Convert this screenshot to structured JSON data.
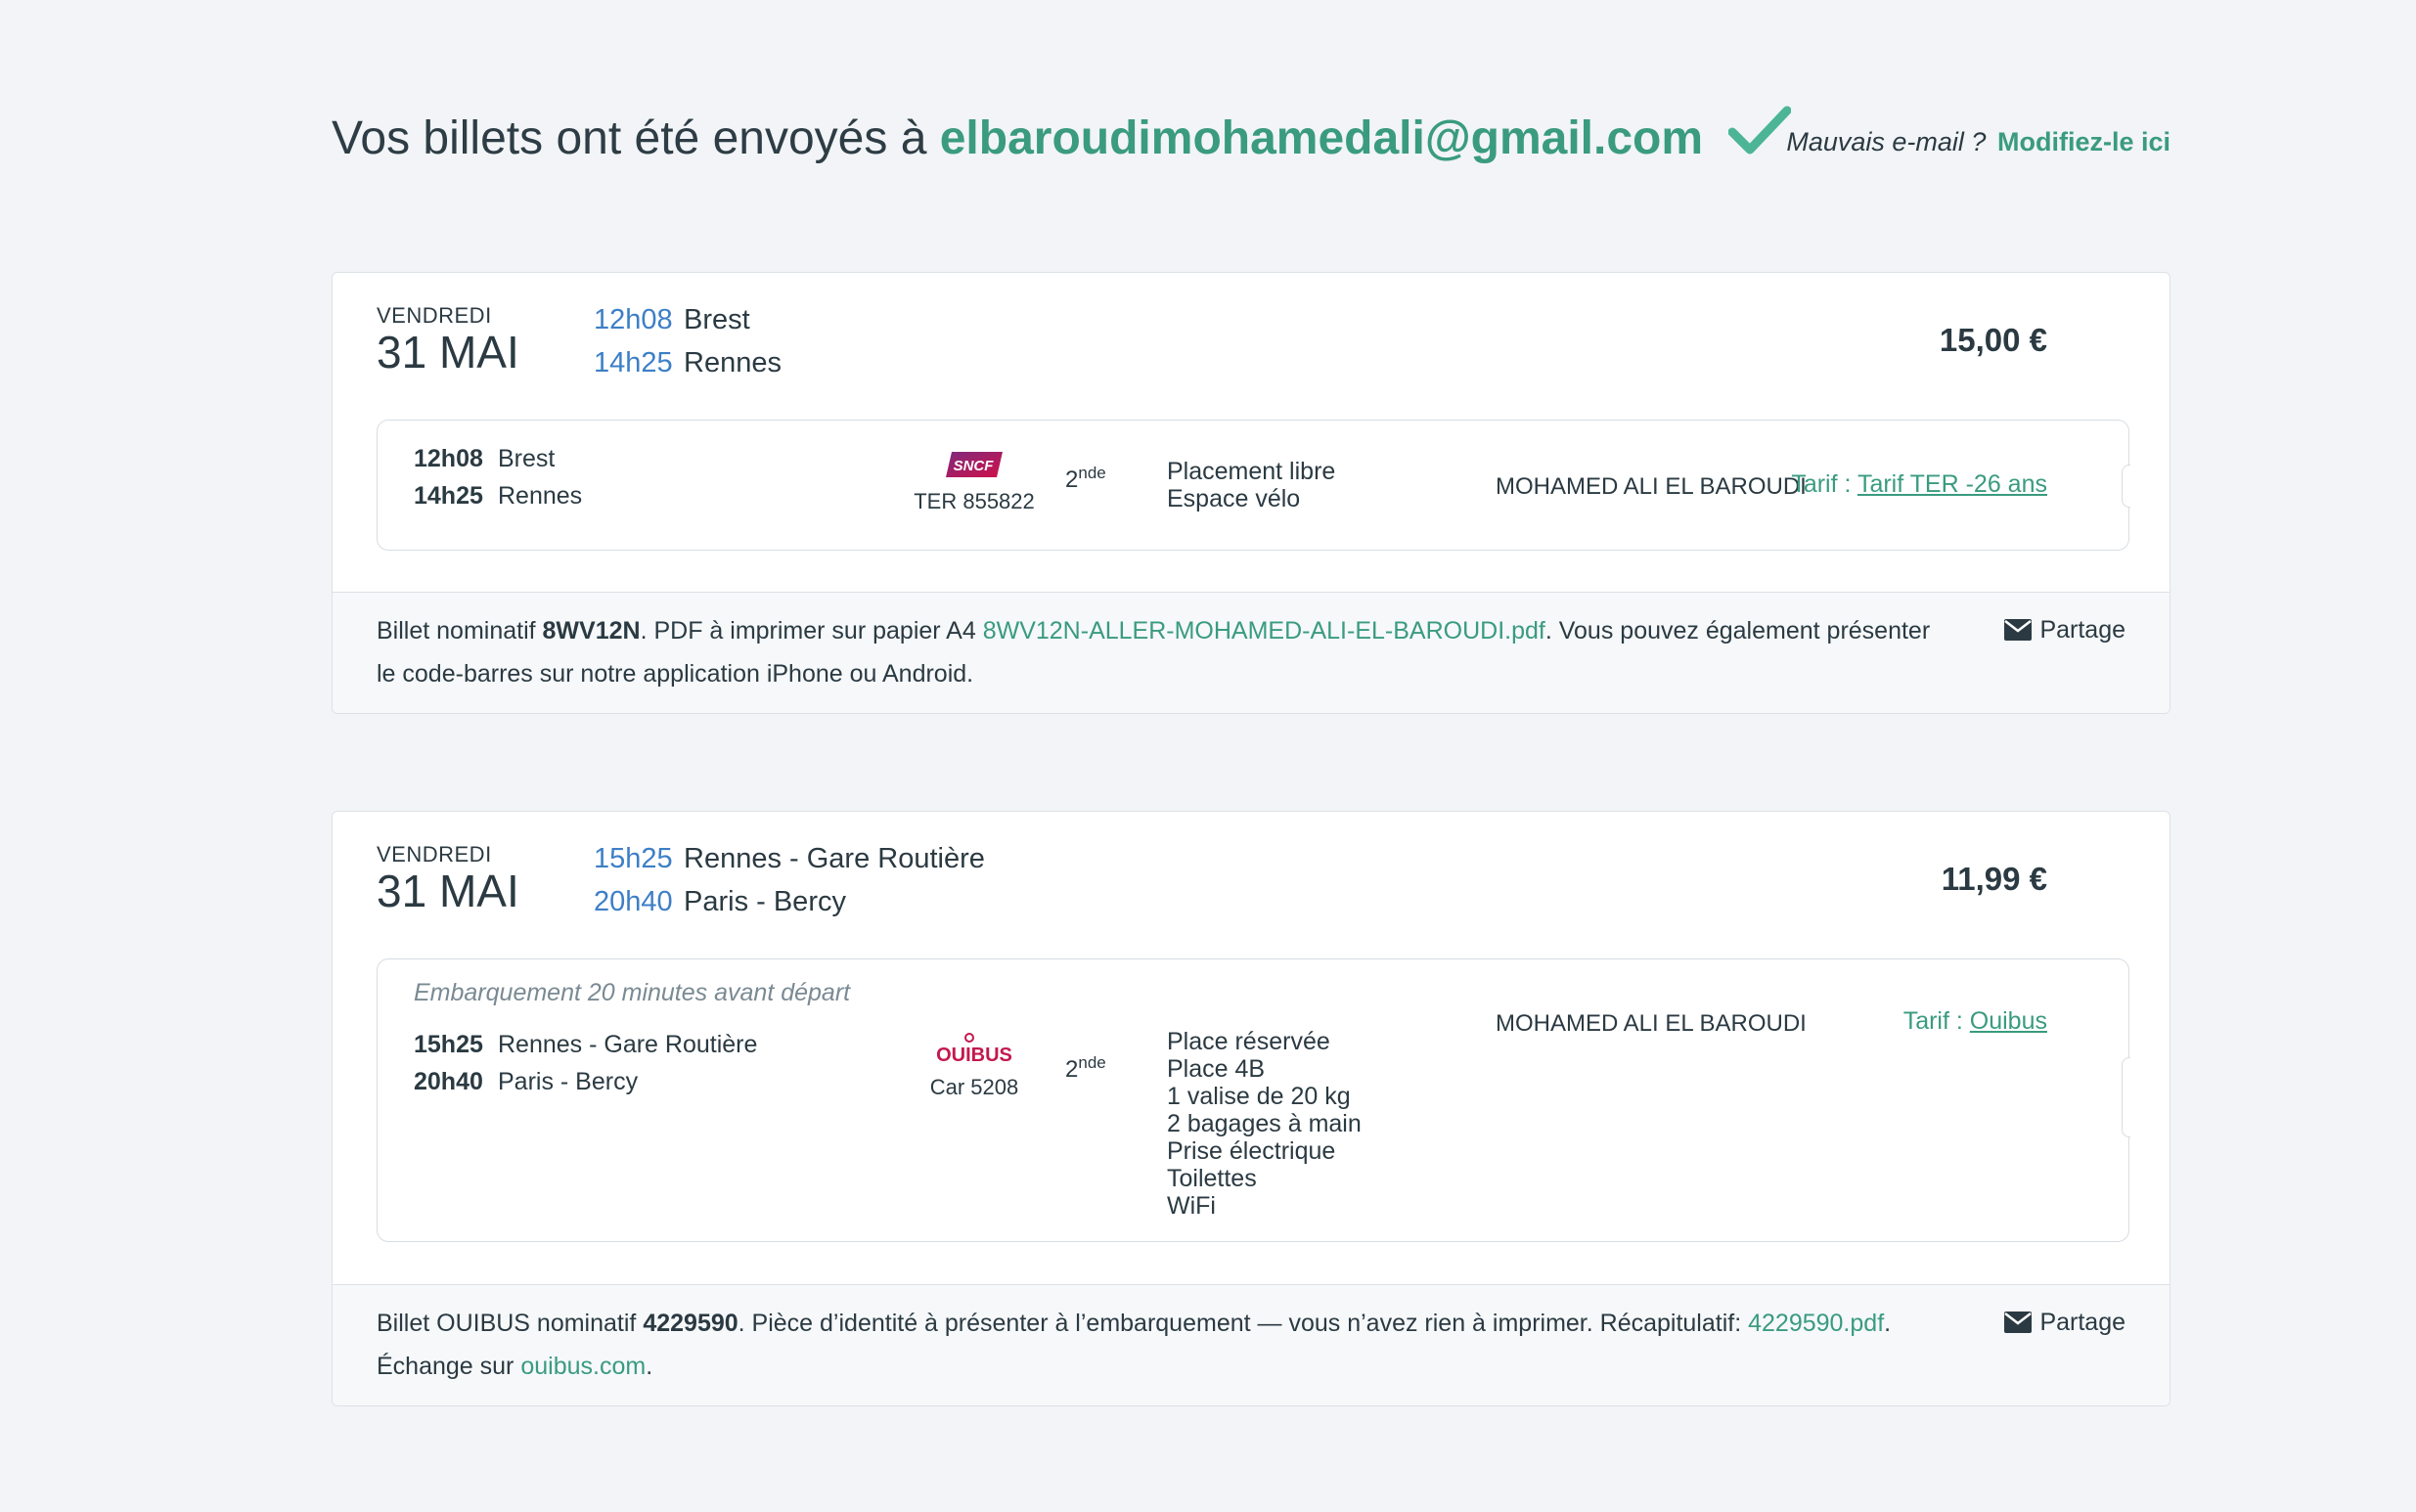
{
  "header": {
    "prefix": "Vos billets ont été envoyés à ",
    "email": "elbaroudimohamedali@gmail.com",
    "wrong_email_label": "Mauvais e-mail ?",
    "wrong_email_link": "Modifiez-le ici"
  },
  "colors": {
    "accent_green": "#3a9b7f",
    "time_blue": "#3d7fc6",
    "sncf_pink": "#b3104b"
  },
  "trips": [
    {
      "day": "VENDREDI",
      "date": "31 MAI",
      "dep_time": "12h08",
      "dep_station": "Brest",
      "arr_time": "14h25",
      "arr_station": "Rennes",
      "price": "15,00 €",
      "segment": {
        "notice": "",
        "dep_time": "12h08",
        "dep_station": "Brest",
        "arr_time": "14h25",
        "arr_station": "Rennes",
        "carrier_logo": "SNCF",
        "carrier_vehicle": "TER 855822",
        "class_main": "2",
        "class_sup": "nde",
        "features": [
          "Placement libre",
          "Espace vélo"
        ],
        "passenger": "MOHAMED ALI EL BAROUDI",
        "fare_label": "Tarif : ",
        "fare_link": "Tarif TER -26 ans"
      },
      "footer": {
        "t1": "Billet nominatif ",
        "ref": "8WV12N",
        "t2": ". PDF à imprimer sur papier A4 ",
        "link1": "8WV12N-ALLER-MOHAMED-ALI-EL-BAROUDI.pdf",
        "t3": ". Vous pouvez également présenter le code-barres sur notre application iPhone ou Android.",
        "link2": "",
        "t4": ""
      },
      "share": "Partage"
    },
    {
      "day": "VENDREDI",
      "date": "31 MAI",
      "dep_time": "15h25",
      "dep_station": "Rennes - Gare Routière",
      "arr_time": "20h40",
      "arr_station": "Paris - Bercy",
      "price": "11,99 €",
      "segment": {
        "notice": "Embarquement 20 minutes avant départ",
        "dep_time": "15h25",
        "dep_station": "Rennes - Gare Routière",
        "arr_time": "20h40",
        "arr_station": "Paris - Bercy",
        "carrier_logo": "OUIBUS",
        "carrier_vehicle": "Car 5208",
        "class_main": "2",
        "class_sup": "nde",
        "features": [
          "Place réservée",
          "Place 4B",
          "1 valise de 20 kg",
          "2 bagages à main",
          "Prise électrique",
          "Toilettes",
          "WiFi"
        ],
        "passenger": "MOHAMED ALI EL BAROUDI",
        "fare_label": "Tarif : ",
        "fare_link": "Ouibus"
      },
      "footer": {
        "t1": "Billet OUIBUS nominatif ",
        "ref": "4229590",
        "t2": ". Pièce d’identité à présenter à l’embarquement — vous n’avez rien à imprimer. Récapitulatif: ",
        "link1": "4229590.pdf",
        "t3": ". Échange sur ",
        "link2": "ouibus.com",
        "t4": "."
      },
      "share": "Partage"
    }
  ],
  "icons": {
    "check": "check-icon",
    "share": "envelope-icon"
  }
}
